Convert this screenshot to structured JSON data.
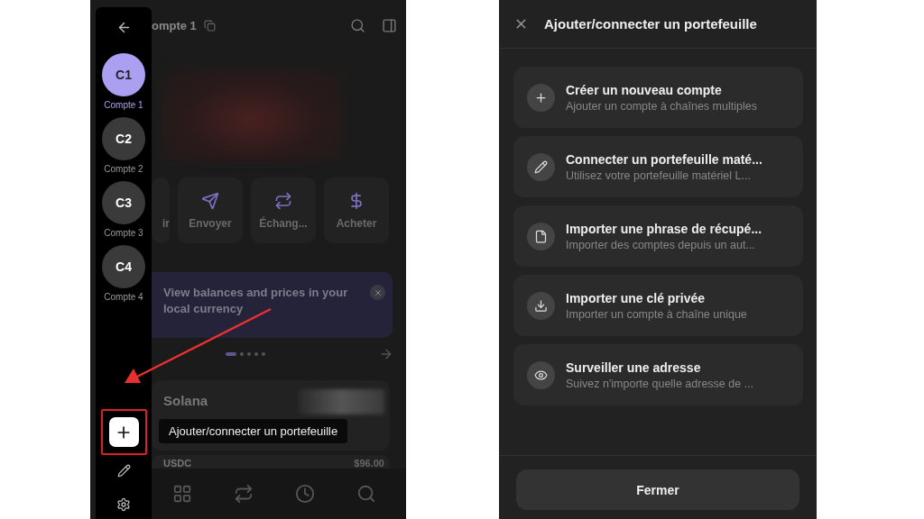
{
  "left_screen": {
    "header": {
      "title": "ompte 1"
    },
    "accounts": [
      {
        "initials": "C1",
        "name": "Compte 1",
        "selected": true
      },
      {
        "initials": "C2",
        "name": "Compte 2",
        "selected": false
      },
      {
        "initials": "C3",
        "name": "Compte 3",
        "selected": false
      },
      {
        "initials": "C4",
        "name": "Compte 4",
        "selected": false
      }
    ],
    "actions": [
      {
        "label": "ir",
        "kind": "receive"
      },
      {
        "label": "Envoyer",
        "kind": "send"
      },
      {
        "label": "Échang...",
        "kind": "swap"
      },
      {
        "label": "Acheter",
        "kind": "buy"
      }
    ],
    "banner": {
      "text": "View balances and prices in your local currency"
    },
    "tokens": [
      {
        "name": "Solana"
      },
      {
        "name": "USDC",
        "value": "$96.00"
      }
    ],
    "tooltip": "Ajouter/connecter un portefeuille"
  },
  "right_screen": {
    "title": "Ajouter/connecter un portefeuille",
    "options": [
      {
        "kind": "plus",
        "title": "Créer un nouveau compte",
        "subtitle": "Ajouter un compte à chaînes multiples"
      },
      {
        "kind": "hardware",
        "title": "Connecter un portefeuille maté...",
        "subtitle": "Utilisez votre portefeuille matériel L..."
      },
      {
        "kind": "file",
        "title": "Importer une phrase de récupé...",
        "subtitle": "Importer des comptes depuis un aut..."
      },
      {
        "kind": "download",
        "title": "Importer une clé privée",
        "subtitle": "Importer un compte à chaîne unique"
      },
      {
        "kind": "eye",
        "title": "Surveiller une adresse",
        "subtitle": "Suivez n'importe quelle adresse de ..."
      }
    ],
    "close_button": "Fermer"
  }
}
